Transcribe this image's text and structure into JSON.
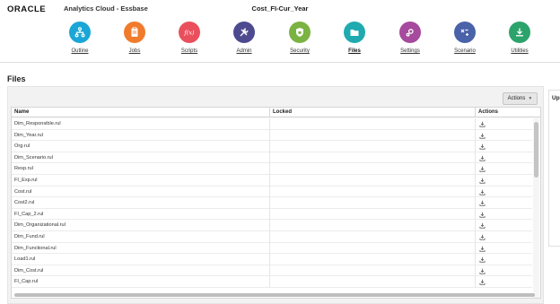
{
  "header": {
    "logo": "ORACLE",
    "product": "Analytics Cloud - Essbase",
    "app_title": "Cost_FI-Cur_Year"
  },
  "nav": [
    {
      "label": "Outline",
      "icon": "outline-icon",
      "color": "#1aa6d6"
    },
    {
      "label": "Jobs",
      "icon": "jobs-icon",
      "color": "#f07b2d"
    },
    {
      "label": "Scripts",
      "icon": "scripts-icon",
      "color": "#ea4f5c"
    },
    {
      "label": "Admin",
      "icon": "admin-icon",
      "color": "#4d4a8f"
    },
    {
      "label": "Security",
      "icon": "security-icon",
      "color": "#7bb342"
    },
    {
      "label": "Files",
      "icon": "files-icon",
      "color": "#1faab0",
      "active": true
    },
    {
      "label": "Settings",
      "icon": "settings-icon",
      "color": "#a54a9c"
    },
    {
      "label": "Scenario",
      "icon": "scenario-icon",
      "color": "#4a62a8"
    },
    {
      "label": "Utilities",
      "icon": "utilities-icon",
      "color": "#2ca36b"
    }
  ],
  "page": {
    "heading": "Files",
    "actions_button": "Actions",
    "side_panel_label": "Up"
  },
  "table": {
    "columns": [
      "Name",
      "Locked",
      "Actions"
    ],
    "rows": [
      {
        "name": "Dim_Responsible.rul",
        "locked": ""
      },
      {
        "name": "Dim_Year.rul",
        "locked": ""
      },
      {
        "name": "Org.rul",
        "locked": ""
      },
      {
        "name": "Dim_Scenario.rul",
        "locked": ""
      },
      {
        "name": "Resp.rul",
        "locked": ""
      },
      {
        "name": "FI_Exp.rul",
        "locked": ""
      },
      {
        "name": "Cost.rul",
        "locked": ""
      },
      {
        "name": "Cost2.rul",
        "locked": ""
      },
      {
        "name": "FI_Cap_2.rul",
        "locked": ""
      },
      {
        "name": "Dim_Organizational.rul",
        "locked": ""
      },
      {
        "name": "Dim_Fund.rul",
        "locked": ""
      },
      {
        "name": "Dim_Functional.rul",
        "locked": ""
      },
      {
        "name": "Load1.rul",
        "locked": ""
      },
      {
        "name": "Dim_Cost.rul",
        "locked": ""
      },
      {
        "name": "FI_Cap.rul",
        "locked": ""
      }
    ]
  }
}
